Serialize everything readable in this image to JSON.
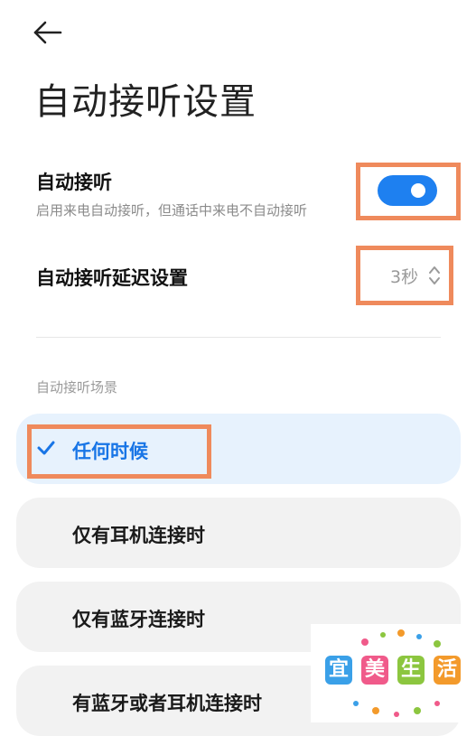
{
  "header": {
    "back_icon": "back-arrow-icon",
    "title": "自动接听设置"
  },
  "auto_answer": {
    "label": "自动接听",
    "description": "启用来电自动接听，但通话中来电不自动接听",
    "toggle_state": "on",
    "accent_color": "#1e80f0"
  },
  "delay": {
    "label": "自动接听延迟设置",
    "value": "3秒",
    "chevron_icon": "chevron-up-down-icon"
  },
  "scenarios": {
    "section_label": "自动接听场景",
    "options": [
      {
        "label": "任何时候",
        "selected": true
      },
      {
        "label": "仅有耳机连接时",
        "selected": false
      },
      {
        "label": "仅有蓝牙连接时",
        "selected": false
      },
      {
        "label": "有蓝牙或者耳机连接时",
        "selected": false
      }
    ],
    "check_icon": "checkmark-icon"
  },
  "watermark": {
    "chars": [
      "宜",
      "美",
      "生",
      "活"
    ],
    "colors": [
      "#3aa0e8",
      "#f05a8a",
      "#8cc63f",
      "#f39a2b"
    ]
  },
  "annotation_color": "#ef8a5c"
}
